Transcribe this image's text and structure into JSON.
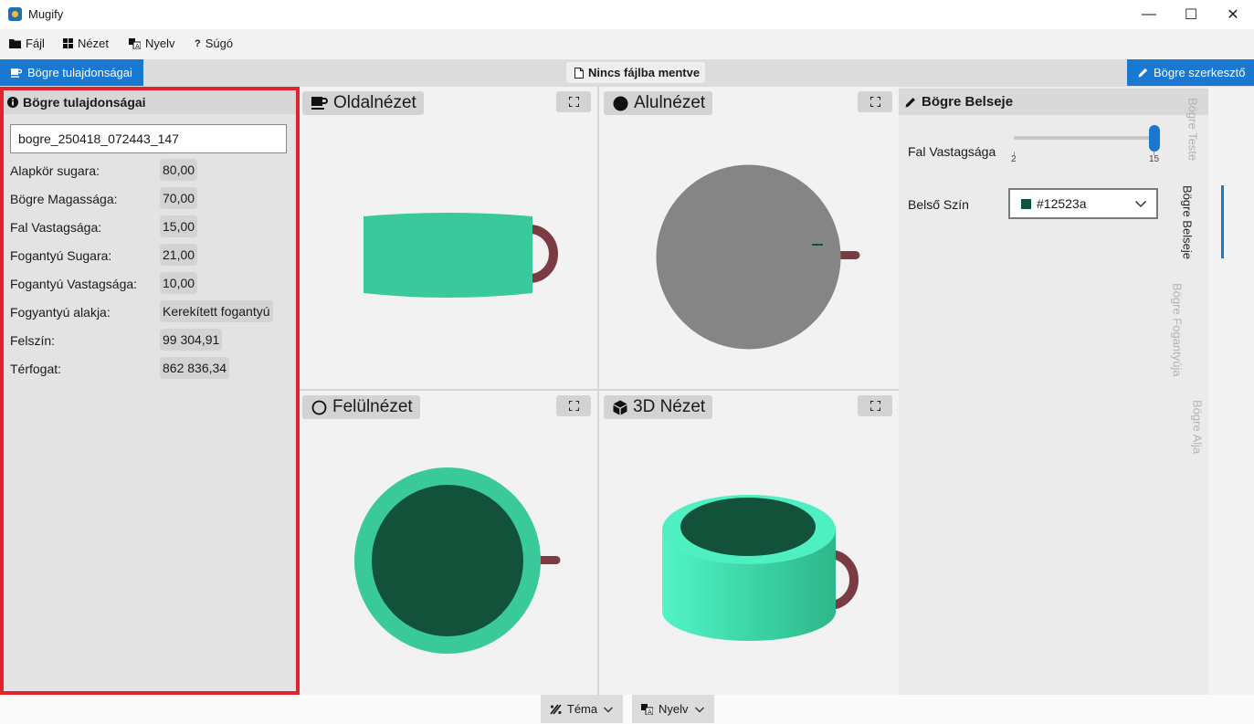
{
  "window": {
    "title": "Mugify",
    "min_glyph": "—",
    "max_glyph": "☐",
    "close_glyph": "✕"
  },
  "menu": [
    {
      "label": "Fájl",
      "icon": "folder-icon"
    },
    {
      "label": "Nézet",
      "icon": "grid-icon"
    },
    {
      "label": "Nyelv",
      "icon": "translate-icon"
    },
    {
      "label": "Súgó",
      "icon": "question-icon"
    }
  ],
  "tabs": {
    "left": "Bögre tulajdonságai",
    "right": "Bögre szerkesztő",
    "file_status": "Nincs fájlba mentve"
  },
  "properties": {
    "header": "Bögre tulajdonságai",
    "name_value": "bogre_250418_072443_147",
    "rows": [
      {
        "label": "Alapkör sugara:",
        "value": "80,00"
      },
      {
        "label": "Bögre Magassága:",
        "value": "70,00"
      },
      {
        "label": "Fal Vastagsága:",
        "value": "15,00"
      },
      {
        "label": "Fogantyú Sugara:",
        "value": "21,00"
      },
      {
        "label": "Fogantyú Vastagsága:",
        "value": "10,00"
      },
      {
        "label": "Fogyantyú alakja:",
        "value": "Kerekített fogantyú"
      },
      {
        "label": "Felszín:",
        "value": "99 304,91"
      },
      {
        "label": "Térfogat:",
        "value": "862 836,34"
      }
    ]
  },
  "viewports": [
    {
      "title": "Oldalnézet",
      "icon": "mug-icon"
    },
    {
      "title": "Alulnézet",
      "icon": "filled-circle-icon"
    },
    {
      "title": "Felülnézet",
      "icon": "hollow-circle-icon"
    },
    {
      "title": "3D Nézet",
      "icon": "cube-icon"
    }
  ],
  "interior": {
    "header": "Bögre Belseje",
    "wall_label": "Fal Vastagsága",
    "slider": {
      "min": "2",
      "max": "15",
      "value": 15
    },
    "color_label": "Belső Szín",
    "color_value": "#12523a"
  },
  "vertical_tabs": [
    "Bögre Teste",
    "Bögre Belseje",
    "Bögre Fogantyúja",
    "Bögre Alja"
  ],
  "bottom": {
    "theme": "Téma",
    "language": "Nyelv"
  },
  "colors": {
    "accent": "#1b78d0",
    "mug_body": "#3ac99a",
    "mug_interior": "#12523a",
    "handle": "#7a3b43",
    "bottom_gray": "#858585",
    "highlight_border": "#e0242e"
  }
}
